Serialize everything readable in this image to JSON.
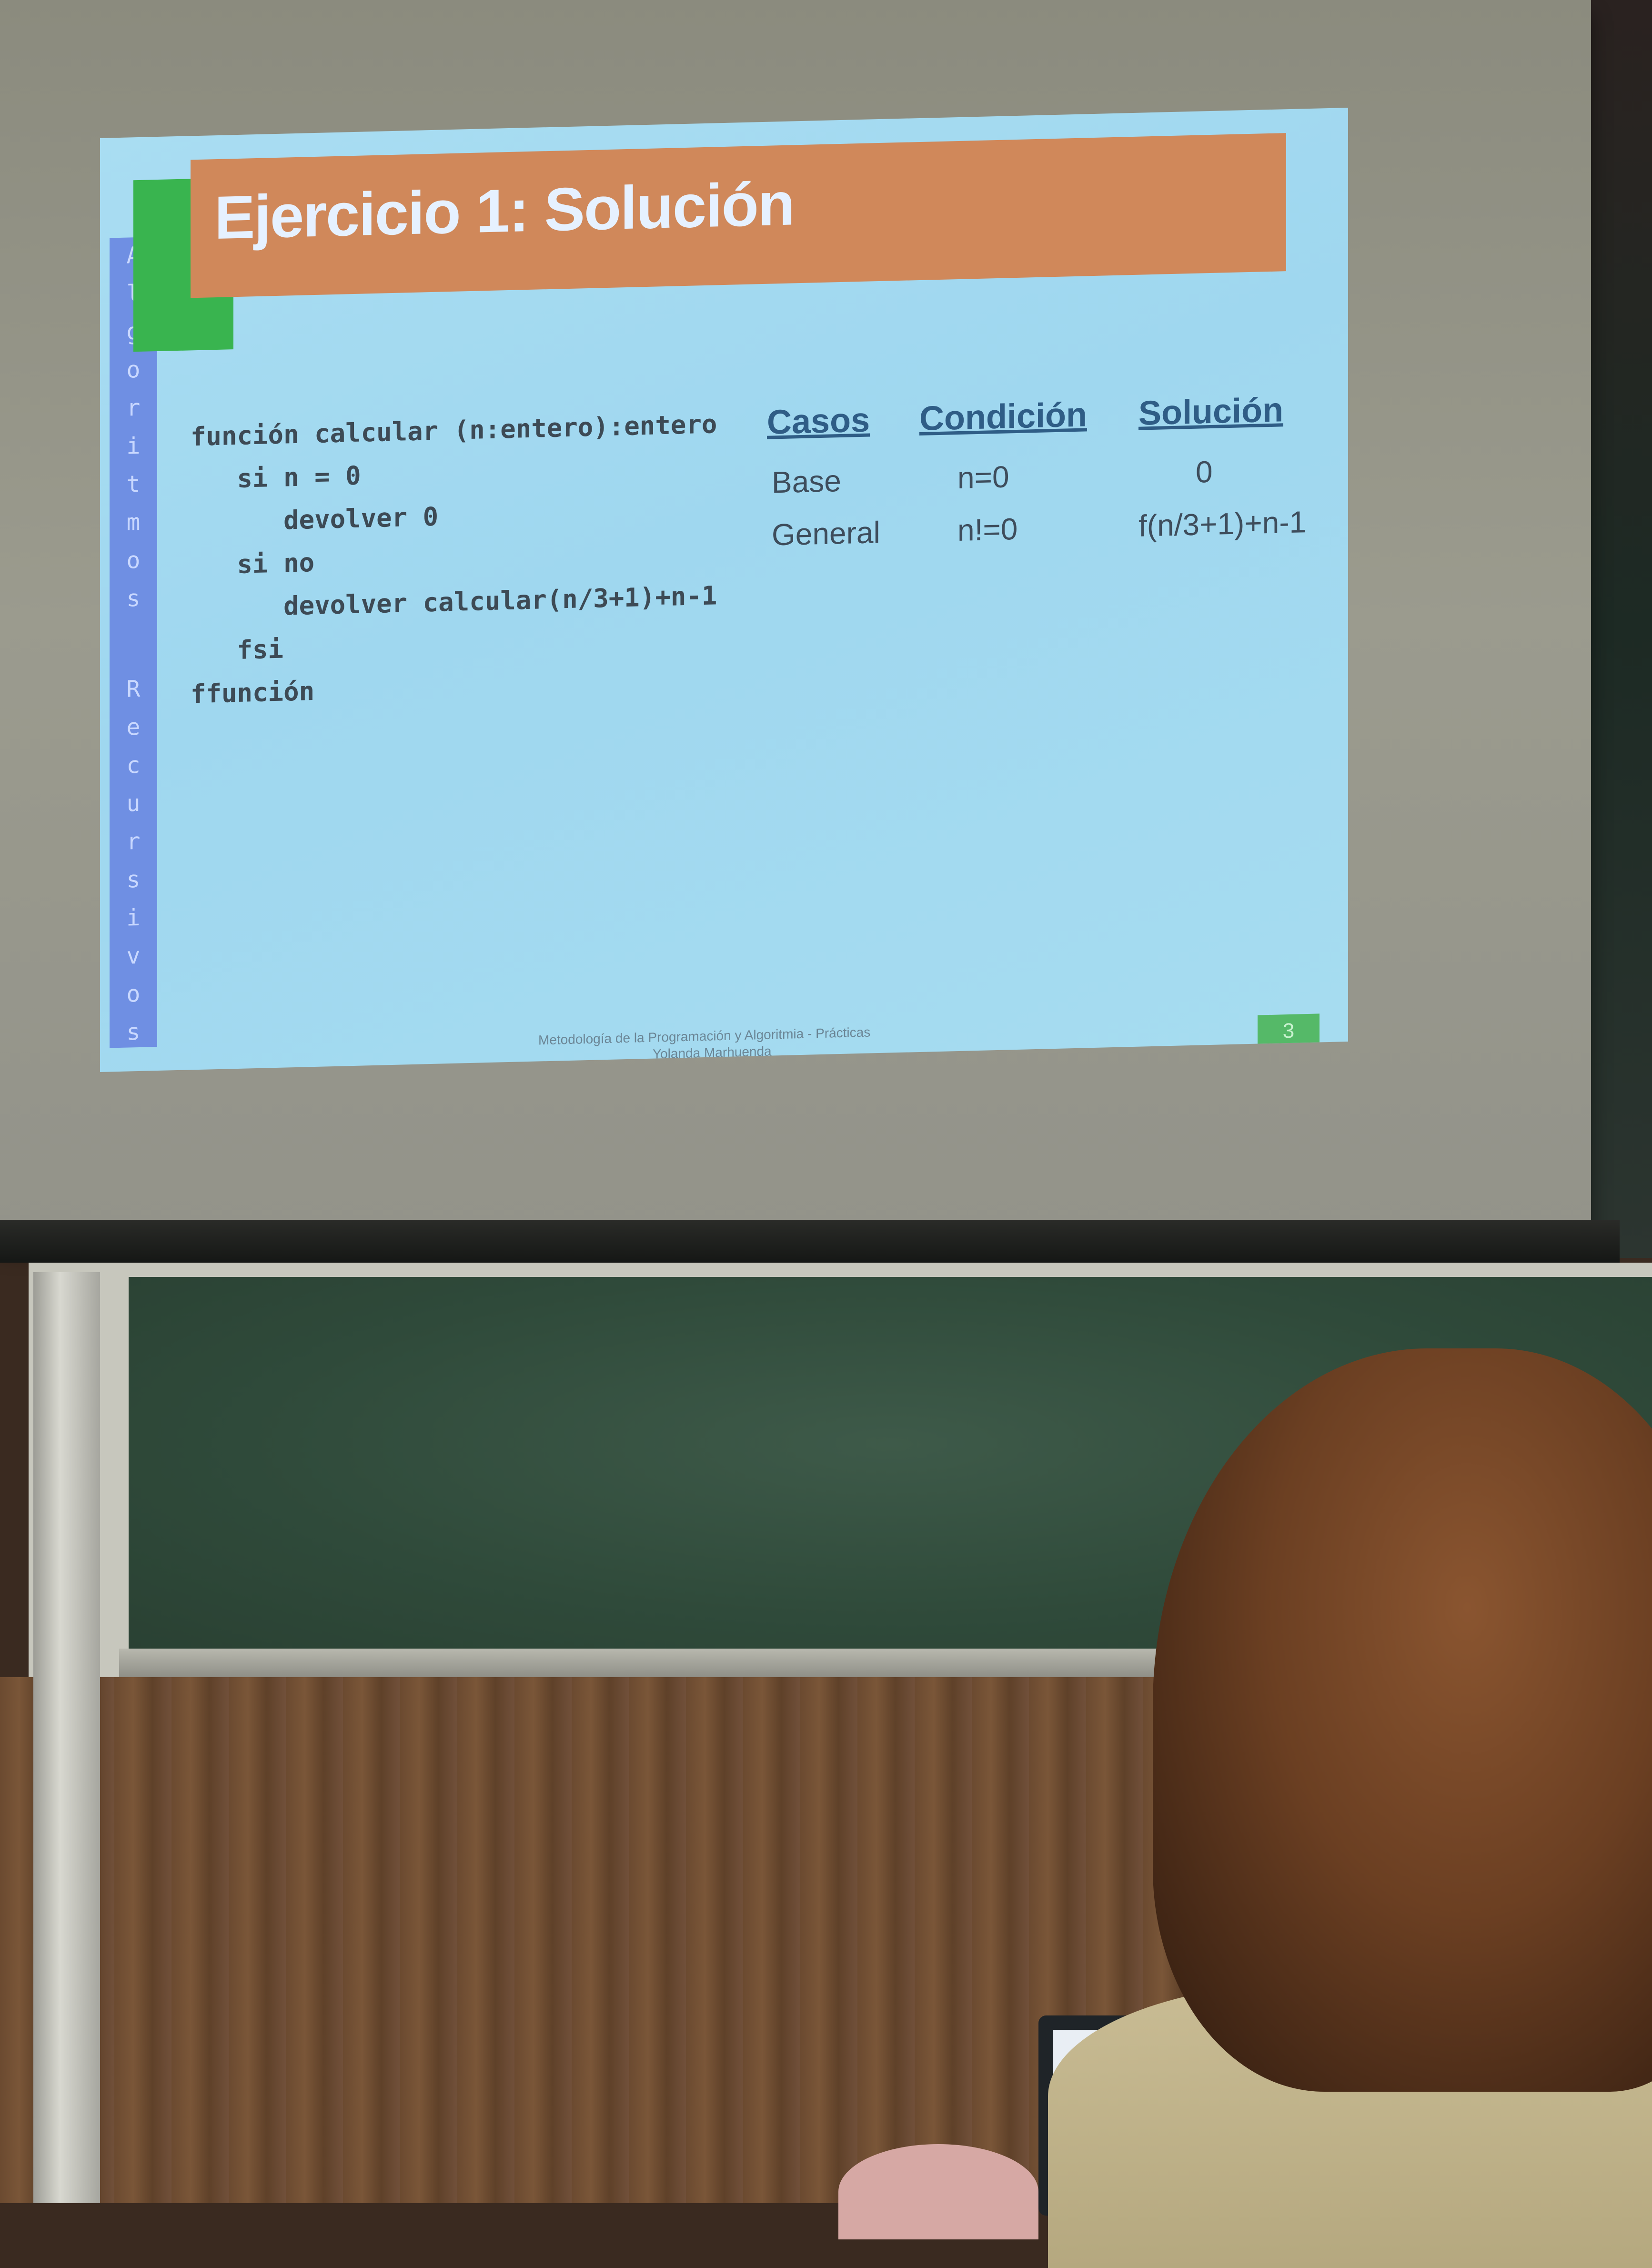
{
  "slide": {
    "title": "Ejercicio 1: Solución",
    "sidebar_letters": [
      "A",
      "l",
      "g",
      "o",
      "r",
      "i",
      "t",
      "m",
      "o",
      "s",
      " ",
      "R",
      "e",
      "c",
      "u",
      "r",
      "s",
      "i",
      "v",
      "o",
      "s"
    ],
    "code": [
      "función calcular (n:entero):entero",
      "   si n = 0",
      "      devolver 0",
      "   si no",
      "      devolver calcular(n/3+1)+n-1",
      "   fsi",
      "ffunción"
    ],
    "table": {
      "headers": [
        "Casos",
        "Condición",
        "Solución"
      ],
      "rows": [
        [
          "Base",
          "n=0",
          "0"
        ],
        [
          "General",
          "n!=0",
          "f(n/3+1)+n-1"
        ]
      ]
    },
    "footer_line1": "Metodología de la Programación y Algoritmia - Prácticas",
    "footer_line2": "Yolanda Marhuenda",
    "page_number": "3"
  },
  "colors": {
    "slide_bg": "#a9ddf2",
    "title_bar": "#d0885a",
    "title_accent": "#39b44f",
    "sidebar": "#6f8fe3",
    "header_text": "#2f5d86"
  }
}
